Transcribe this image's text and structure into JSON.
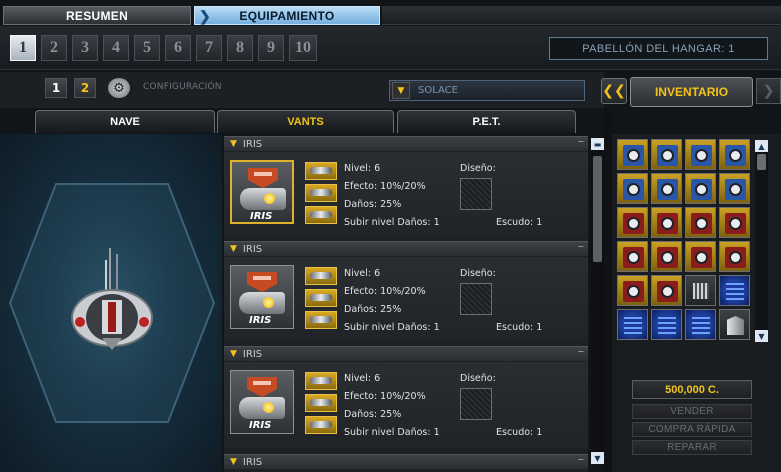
{
  "top_tabs": {
    "resumen": "RESUMEN",
    "equipamiento": "EQUIPAMIENTO"
  },
  "config_numbers": [
    "1",
    "2",
    "3",
    "4",
    "5",
    "6",
    "7",
    "8",
    "9",
    "10"
  ],
  "active_config": "1",
  "hangar": {
    "label": "PABELLÓN DEL HANGAR: 1"
  },
  "config_toggle": {
    "one": "1",
    "two": "2",
    "label": "CONFIGURACIÓN"
  },
  "ship_select": {
    "value": "SOLACE"
  },
  "inventory": {
    "title": "INVENTARIO",
    "prev": "❮❮",
    "next": "❯",
    "credits": "500,000 C.",
    "sell": "VENDER",
    "quick_buy": "COMPRA RÁPIDA",
    "repair": "REPARAR"
  },
  "sub_tabs": {
    "nave": "NAVE",
    "vants": "VANTS",
    "pet": "P.E.T."
  },
  "vants": [
    {
      "name": "IRIS",
      "icon_label": "IRIS",
      "level": "Nivel: 6",
      "effect": "Efecto: 10%/20%",
      "damage": "Daños: 25%",
      "upgrade_damage": "Subir nivel Daños: 1",
      "design": "Diseño:",
      "shield": "Escudo: 1"
    },
    {
      "name": "IRIS",
      "icon_label": "IRIS",
      "level": "Nivel: 6",
      "effect": "Efecto: 10%/20%",
      "damage": "Daños: 25%",
      "upgrade_damage": "Subir nivel Daños: 1",
      "design": "Diseño:",
      "shield": "Escudo: 1"
    },
    {
      "name": "IRIS",
      "icon_label": "IRIS",
      "level": "Nivel: 6",
      "effect": "Efecto: 10%/20%",
      "damage": "Daños: 25%",
      "upgrade_damage": "Subir nivel Daños: 1",
      "design": "Diseño:",
      "shield": "Escudo: 1"
    },
    {
      "name": "IRIS"
    }
  ],
  "colors": {
    "accent_yellow": "#f2c318",
    "tab_blue": "#74aee0"
  }
}
